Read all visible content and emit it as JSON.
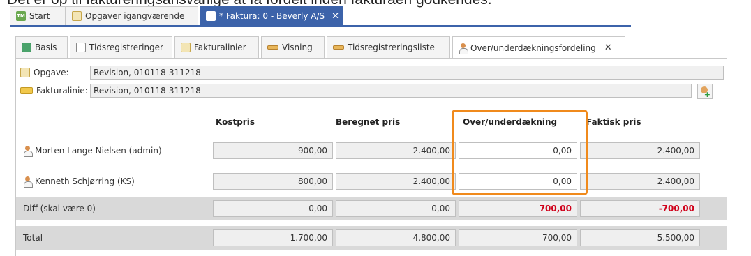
{
  "caption": "Det er op til faktureringsansvarlige at få fordelt inden fakturaen godkendes.",
  "top_tabs": [
    {
      "label": "Start",
      "icon": "tm-logo-icon"
    },
    {
      "label": "Opgaver igangværende",
      "icon": "task-icon"
    },
    {
      "label": "* Faktura: 0 - Beverly A/S",
      "icon": "invoice-icon",
      "close": "✕"
    }
  ],
  "sub_tabs": [
    {
      "label": "Basis",
      "icon": "invoice-icon"
    },
    {
      "label": "Tidsregistreringer",
      "icon": "time-grid-icon"
    },
    {
      "label": "Fakturalinier",
      "icon": "task-icon"
    },
    {
      "label": "Visning",
      "icon": "bar-icon"
    },
    {
      "label": "Tidsregistreringsliste",
      "icon": "bar-icon"
    },
    {
      "label": "Over/underdækningsfordeling",
      "icon": "coins-person-icon",
      "close": "✕"
    }
  ],
  "fields": {
    "opgave_label": "Opgave:",
    "opgave_value": "Revision, 010118-311218",
    "fakturalinie_label": "Fakturalinie:",
    "fakturalinie_value": "Revision, 010118-311218"
  },
  "columns": {
    "kostpris": "Kostpris",
    "beregnet": "Beregnet pris",
    "over": "Over/underdækning",
    "faktisk": "Faktisk pris"
  },
  "rows": [
    {
      "name": "Morten Lange Nielsen (admin)",
      "kostpris": "900,00",
      "beregnet": "2.400,00",
      "over": "0,00",
      "faktisk": "2.400,00"
    },
    {
      "name": "Kenneth  Schjørring (KS)",
      "kostpris": "800,00",
      "beregnet": "2.400,00",
      "over": "0,00",
      "faktisk": "2.400,00"
    }
  ],
  "diff": {
    "label": "Diff (skal være 0)",
    "kostpris": "0,00",
    "beregnet": "0,00",
    "over": "700,00",
    "faktisk": "-700,00"
  },
  "total": {
    "label": "Total",
    "kostpris": "1.700,00",
    "beregnet": "4.800,00",
    "over": "700,00",
    "faktisk": "5.500,00"
  },
  "colors": {
    "accent": "#3c63aa",
    "highlight": "#f08a1c",
    "negative": "#d0021b"
  }
}
